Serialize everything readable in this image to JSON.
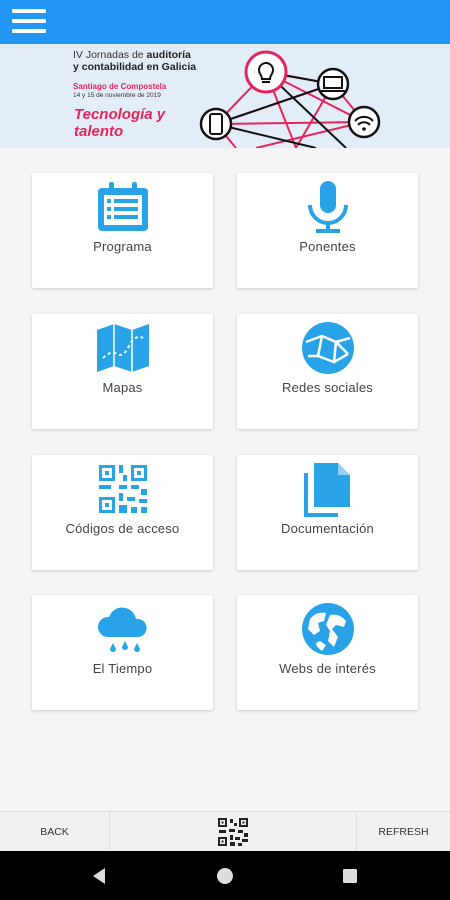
{
  "colors": {
    "accent": "#2196f3",
    "banner_pink": "#e5245a"
  },
  "appbar": {
    "menu_icon": "hamburger-icon"
  },
  "banner": {
    "line1_prefix": "IV Jornadas de ",
    "line1_bold": "auditoría",
    "line2": "y contabilidad en Galicia",
    "place": "Santiago de Compostela",
    "dates": "14 y 15 de noviembre de 2019",
    "slogan": "Tecnología y talento"
  },
  "menu": [
    {
      "label": "Programa",
      "icon": "calendar-icon"
    },
    {
      "label": "Ponentes",
      "icon": "microphone-icon"
    },
    {
      "label": "Mapas",
      "icon": "map-icon"
    },
    {
      "label": "Redes sociales",
      "icon": "network-globe-icon"
    },
    {
      "label": "Códigos de acceso",
      "icon": "qr-code-icon"
    },
    {
      "label": "Documentación",
      "icon": "documents-icon"
    },
    {
      "label": "El Tiempo",
      "icon": "rain-cloud-icon"
    },
    {
      "label": "Webs de interés",
      "icon": "globe-icon"
    }
  ],
  "bottom": {
    "back": "BACK",
    "refresh": "REFRESH",
    "qr_icon": "qr-code-icon"
  },
  "system_nav": {
    "back": "nav-back-icon",
    "home": "nav-home-icon",
    "recents": "nav-recents-icon"
  }
}
